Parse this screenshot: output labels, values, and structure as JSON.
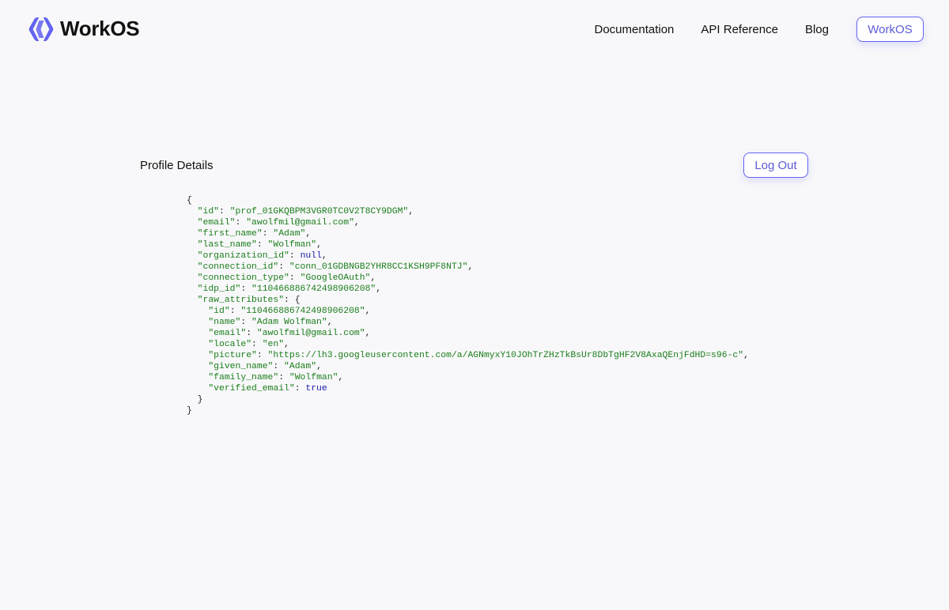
{
  "header": {
    "logo_text": "WorkOS",
    "nav": [
      {
        "label": "Documentation"
      },
      {
        "label": "API Reference"
      },
      {
        "label": "Blog"
      }
    ],
    "cta_label": "WorkOS"
  },
  "profile": {
    "title": "Profile Details",
    "logout_label": "Log Out"
  },
  "json_lines": [
    {
      "indent": 0,
      "parts": [
        [
          "p",
          "{"
        ]
      ]
    },
    {
      "indent": 1,
      "parts": [
        [
          "k",
          "\"id\""
        ],
        [
          "p",
          ": "
        ],
        [
          "s",
          "\"prof_01GKQBPM3VGR0TC0V2T8CY9DGM\""
        ],
        [
          "p",
          ","
        ]
      ]
    },
    {
      "indent": 1,
      "parts": [
        [
          "k",
          "\"email\""
        ],
        [
          "p",
          ": "
        ],
        [
          "s",
          "\"awolfmil@gmail.com\""
        ],
        [
          "p",
          ","
        ]
      ]
    },
    {
      "indent": 1,
      "parts": [
        [
          "k",
          "\"first_name\""
        ],
        [
          "p",
          ": "
        ],
        [
          "s",
          "\"Adam\""
        ],
        [
          "p",
          ","
        ]
      ]
    },
    {
      "indent": 1,
      "parts": [
        [
          "k",
          "\"last_name\""
        ],
        [
          "p",
          ": "
        ],
        [
          "s",
          "\"Wolfman\""
        ],
        [
          "p",
          ","
        ]
      ]
    },
    {
      "indent": 1,
      "parts": [
        [
          "k",
          "\"organization_id\""
        ],
        [
          "p",
          ": "
        ],
        [
          "kw",
          "null"
        ],
        [
          "p",
          ","
        ]
      ]
    },
    {
      "indent": 1,
      "parts": [
        [
          "k",
          "\"connection_id\""
        ],
        [
          "p",
          ": "
        ],
        [
          "s",
          "\"conn_01GDBNGB2YHR8CC1KSH9PF8NTJ\""
        ],
        [
          "p",
          ","
        ]
      ]
    },
    {
      "indent": 1,
      "parts": [
        [
          "k",
          "\"connection_type\""
        ],
        [
          "p",
          ": "
        ],
        [
          "s",
          "\"GoogleOAuth\""
        ],
        [
          "p",
          ","
        ]
      ]
    },
    {
      "indent": 1,
      "parts": [
        [
          "k",
          "\"idp_id\""
        ],
        [
          "p",
          ": "
        ],
        [
          "s",
          "\"110466886742498906208\""
        ],
        [
          "p",
          ","
        ]
      ]
    },
    {
      "indent": 1,
      "parts": [
        [
          "k",
          "\"raw_attributes\""
        ],
        [
          "p",
          ": {"
        ]
      ]
    },
    {
      "indent": 2,
      "parts": [
        [
          "k",
          "\"id\""
        ],
        [
          "p",
          ": "
        ],
        [
          "s",
          "\"110466886742498906208\""
        ],
        [
          "p",
          ","
        ]
      ]
    },
    {
      "indent": 2,
      "parts": [
        [
          "k",
          "\"name\""
        ],
        [
          "p",
          ": "
        ],
        [
          "s",
          "\"Adam Wolfman\""
        ],
        [
          "p",
          ","
        ]
      ]
    },
    {
      "indent": 2,
      "parts": [
        [
          "k",
          "\"email\""
        ],
        [
          "p",
          ": "
        ],
        [
          "s",
          "\"awolfmil@gmail.com\""
        ],
        [
          "p",
          ","
        ]
      ]
    },
    {
      "indent": 2,
      "parts": [
        [
          "k",
          "\"locale\""
        ],
        [
          "p",
          ": "
        ],
        [
          "s",
          "\"en\""
        ],
        [
          "p",
          ","
        ]
      ]
    },
    {
      "indent": 2,
      "parts": [
        [
          "k",
          "\"picture\""
        ],
        [
          "p",
          ": "
        ],
        [
          "s",
          "\"https://lh3.googleusercontent.com/a/AGNmyxY10JOhTrZHzTkBsUr8DbTgHF2V8AxaQEnjFdHD=s96-c\""
        ],
        [
          "p",
          ","
        ]
      ]
    },
    {
      "indent": 2,
      "parts": [
        [
          "k",
          "\"given_name\""
        ],
        [
          "p",
          ": "
        ],
        [
          "s",
          "\"Adam\""
        ],
        [
          "p",
          ","
        ]
      ]
    },
    {
      "indent": 2,
      "parts": [
        [
          "k",
          "\"family_name\""
        ],
        [
          "p",
          ": "
        ],
        [
          "s",
          "\"Wolfman\""
        ],
        [
          "p",
          ","
        ]
      ]
    },
    {
      "indent": 2,
      "parts": [
        [
          "k",
          "\"verified_email\""
        ],
        [
          "p",
          ": "
        ],
        [
          "kw",
          "true"
        ]
      ]
    },
    {
      "indent": 1,
      "parts": [
        [
          "p",
          "}"
        ]
      ]
    },
    {
      "indent": 0,
      "parts": [
        [
          "p",
          "}"
        ]
      ]
    }
  ],
  "colors": {
    "accent": "#6363f1",
    "json_string": "#1a7d1a",
    "json_keyword": "#1a1aa6",
    "background": "#f8f8fa"
  },
  "icons": {
    "logo": "workos-logo-icon"
  }
}
